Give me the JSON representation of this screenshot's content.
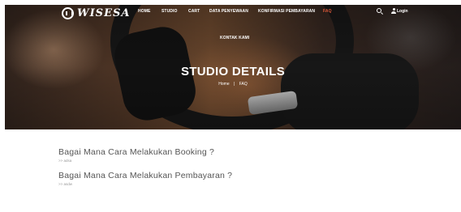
{
  "brand": {
    "logo_text": "WISESA"
  },
  "nav": {
    "items": [
      {
        "label": "HOME"
      },
      {
        "label": "STUDIO"
      },
      {
        "label": "CART"
      },
      {
        "label": "DATA PENYEWAAN"
      },
      {
        "label": "KONFIRMASI PEMBAYARAN"
      },
      {
        "label": "FAQ",
        "active": true
      },
      {
        "label": "KONTAK KAMI"
      }
    ],
    "login_label": "Login",
    "active_color": "#e25a3a"
  },
  "hero": {
    "title": "STUDIO DETAILS",
    "breadcrumb": {
      "home": "Home",
      "separator": "|",
      "current": "FAQ"
    }
  },
  "faq": [
    {
      "question": "Bagai Mana Cara Melakukan Booking ?",
      "answer": ">> adsa"
    },
    {
      "question": "Bagai Mana Cara Melakukan Pembayaran ?",
      "answer": ">> asdw"
    }
  ]
}
